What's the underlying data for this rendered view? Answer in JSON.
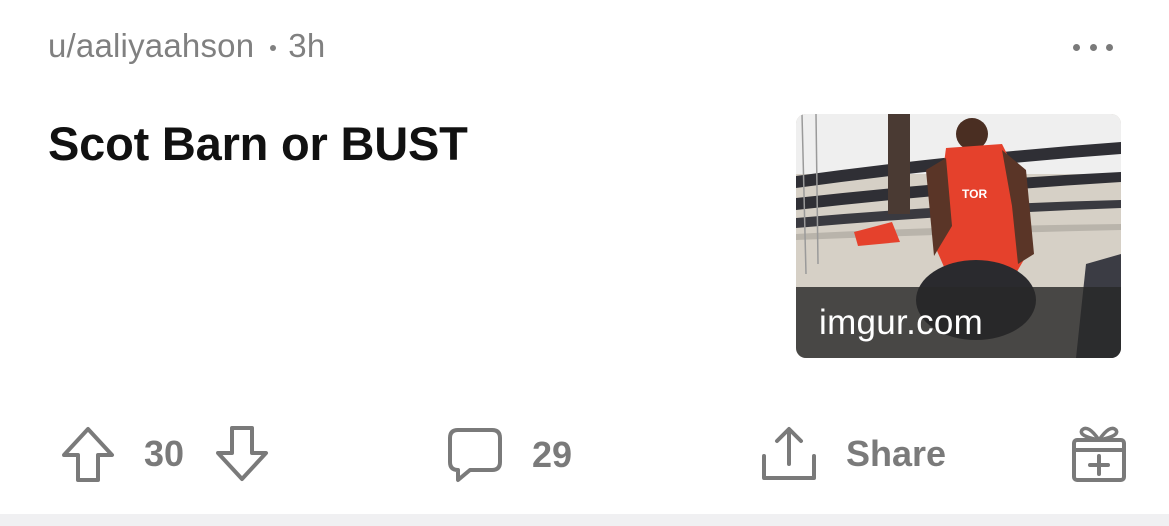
{
  "post": {
    "author": "u/aaliyaahson",
    "age": "3h",
    "title": "Scot Barn or BUST",
    "thumbnail": {
      "domain": "imgur.com"
    },
    "votes": "30",
    "comments": "29",
    "share_label": "Share"
  },
  "icons": {
    "more": "more-options-icon",
    "upvote": "upvote-arrow-icon",
    "downvote": "downvote-arrow-icon",
    "comment": "comment-bubble-icon",
    "share": "share-icon",
    "gift": "gift-award-icon"
  },
  "colors": {
    "meta_text": "#808080",
    "title_text": "#111111",
    "icon_gray": "#7a7a7a",
    "jersey_red": "#e5412c"
  }
}
